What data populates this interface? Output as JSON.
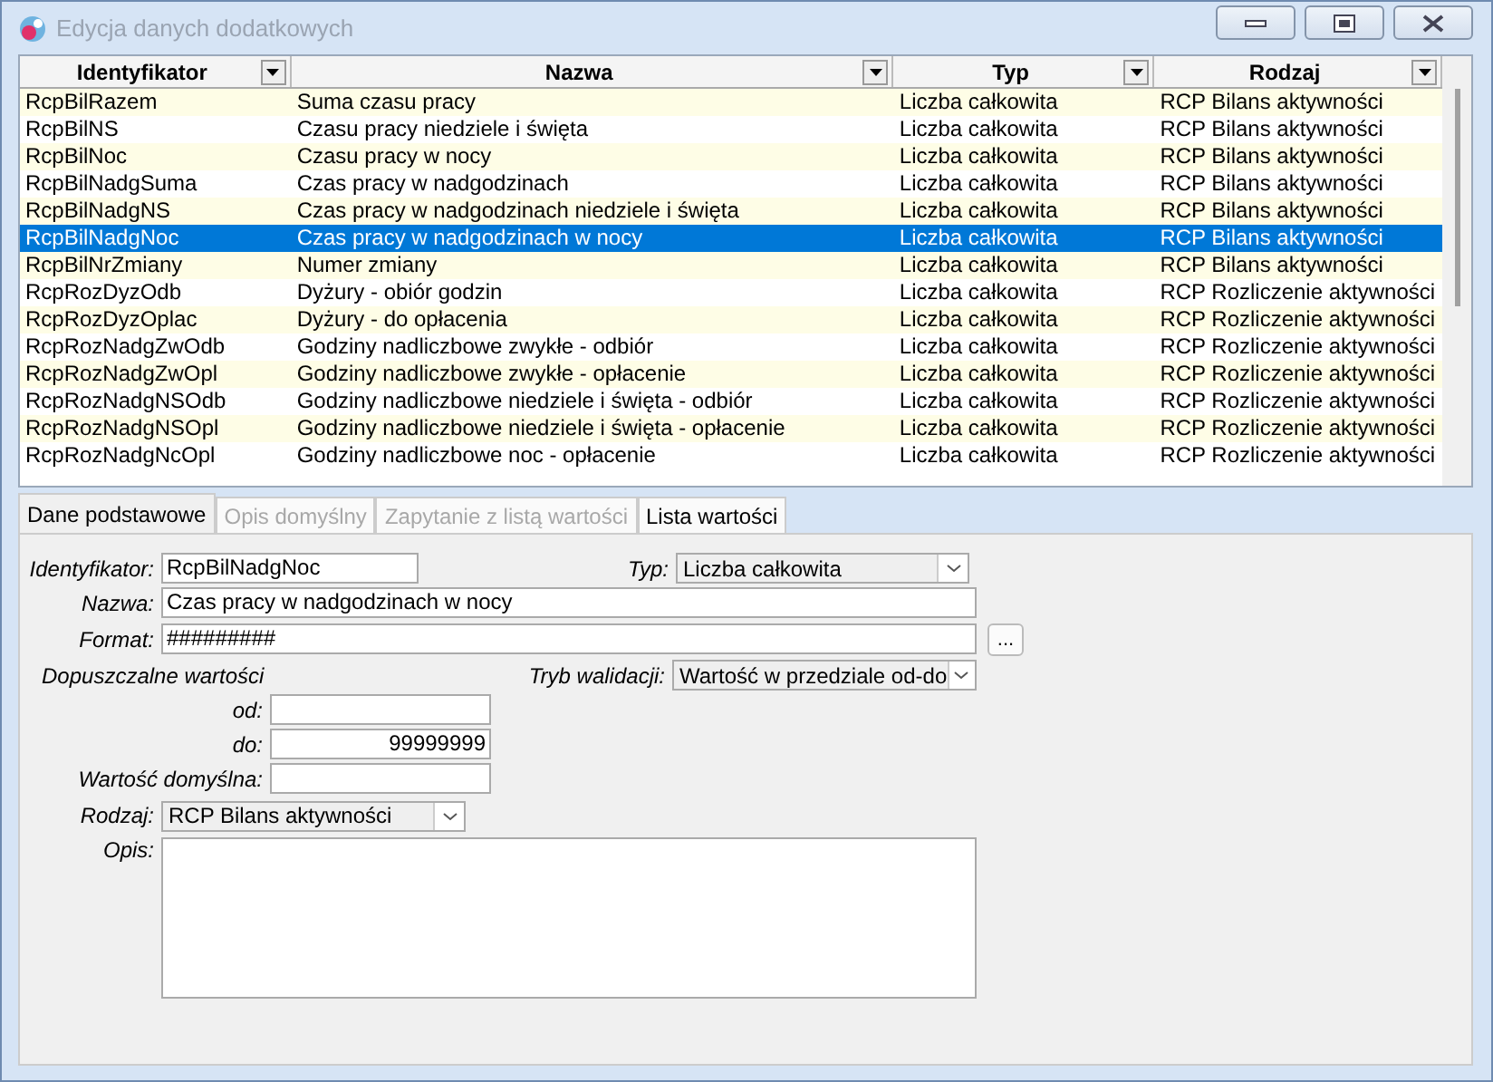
{
  "window": {
    "title": "Edycja danych dodatkowych"
  },
  "table": {
    "columns": [
      {
        "label": "Identyfikator",
        "filter": true
      },
      {
        "label": "Nazwa",
        "filter": true
      },
      {
        "label": "Typ",
        "filter": true
      },
      {
        "label": "Rodzaj",
        "filter": true
      }
    ],
    "rows": [
      {
        "cells": [
          "RcpBilRazem",
          "Suma czasu pracy",
          "Liczba całkowita",
          "RCP Bilans aktywności"
        ],
        "selected": false
      },
      {
        "cells": [
          "RcpBilNS",
          "Czasu pracy niedziele i święta",
          "Liczba całkowita",
          "RCP Bilans aktywności"
        ],
        "selected": false
      },
      {
        "cells": [
          "RcpBilNoc",
          "Czasu pracy w nocy",
          "Liczba całkowita",
          "RCP Bilans aktywności"
        ],
        "selected": false
      },
      {
        "cells": [
          "RcpBilNadgSuma",
          "Czas pracy w nadgodzinach",
          "Liczba całkowita",
          "RCP Bilans aktywności"
        ],
        "selected": false
      },
      {
        "cells": [
          "RcpBilNadgNS",
          "Czas pracy w nadgodzinach niedziele i święta",
          "Liczba całkowita",
          "RCP Bilans aktywności"
        ],
        "selected": false
      },
      {
        "cells": [
          "RcpBilNadgNoc",
          "Czas pracy w nadgodzinach w nocy",
          "Liczba całkowita",
          "RCP Bilans aktywności"
        ],
        "selected": true
      },
      {
        "cells": [
          "RcpBilNrZmiany",
          "Numer zmiany",
          "Liczba całkowita",
          "RCP Bilans aktywności"
        ],
        "selected": false
      },
      {
        "cells": [
          "RcpRozDyzOdb",
          "Dyżury - obiór godzin",
          "Liczba całkowita",
          "RCP Rozliczenie aktywności"
        ],
        "selected": false
      },
      {
        "cells": [
          "RcpRozDyzOplac",
          "Dyżury - do opłacenia",
          "Liczba całkowita",
          "RCP Rozliczenie aktywności"
        ],
        "selected": false
      },
      {
        "cells": [
          "RcpRozNadgZwOdb",
          "Godziny nadliczbowe zwykłe - odbiór",
          "Liczba całkowita",
          "RCP Rozliczenie aktywności"
        ],
        "selected": false
      },
      {
        "cells": [
          "RcpRozNadgZwOpl",
          "Godziny nadliczbowe zwykłe - opłacenie",
          "Liczba całkowita",
          "RCP Rozliczenie aktywności"
        ],
        "selected": false
      },
      {
        "cells": [
          "RcpRozNadgNSOdb",
          "Godziny nadliczbowe niedziele i święta - odbiór",
          "Liczba całkowita",
          "RCP Rozliczenie aktywności"
        ],
        "selected": false
      },
      {
        "cells": [
          "RcpRozNadgNSOpl",
          "Godziny nadliczbowe niedziele i święta - opłacenie",
          "Liczba całkowita",
          "RCP Rozliczenie aktywności"
        ],
        "selected": false
      },
      {
        "cells": [
          "RcpRozNadgNcOpl",
          "Godziny nadliczbowe noc - opłacenie",
          "Liczba całkowita",
          "RCP Rozliczenie aktywności"
        ],
        "selected": false
      }
    ]
  },
  "tabs": [
    {
      "label": "Dane podstawowe",
      "selected": true,
      "disabled": false
    },
    {
      "label": "Opis domyślny",
      "selected": false,
      "disabled": true
    },
    {
      "label": "Zapytanie z listą wartości",
      "selected": false,
      "disabled": true
    },
    {
      "label": "Lista wartości",
      "selected": false,
      "disabled": false
    }
  ],
  "form": {
    "identyfikator": {
      "label": "Identyfikator:",
      "value": "RcpBilNadgNoc"
    },
    "typ": {
      "label": "Typ:",
      "value": "Liczba całkowita"
    },
    "nazwa": {
      "label": "Nazwa:",
      "value": "Czas pracy w nadgodzinach w nocy"
    },
    "format": {
      "label": "Format:",
      "value": "#########",
      "button": "..."
    },
    "allowed_heading": "Dopuszczalne wartości",
    "tryb": {
      "label": "Tryb walidacji:",
      "value": "Wartość w przedziale od-do"
    },
    "od": {
      "label": "od:"
    },
    "do": {
      "label": "do:",
      "value": "99999999"
    },
    "domyslna": {
      "label": "Wartość domyślna:"
    },
    "rodzaj": {
      "label": "Rodzaj:",
      "value": "RCP Bilans aktywności"
    },
    "opis": {
      "label": "Opis:"
    }
  }
}
